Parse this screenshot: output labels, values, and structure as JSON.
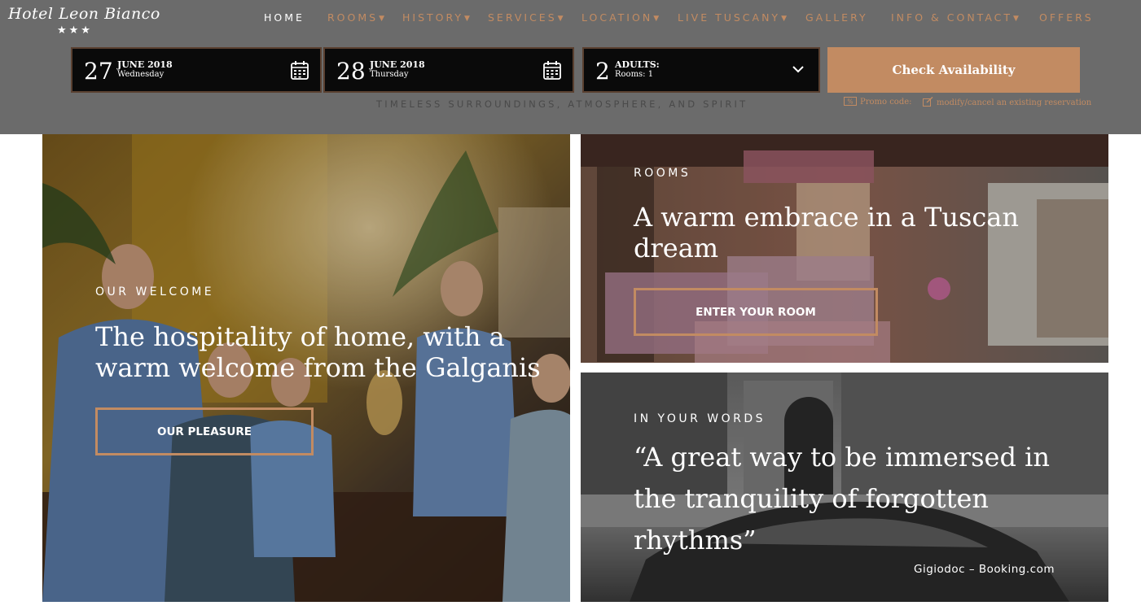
{
  "logo": {
    "name": "Hotel Leon Bianco",
    "stars": "★★★"
  },
  "nav": [
    {
      "label": "HOME",
      "has_dropdown": false,
      "active": true
    },
    {
      "label": "ROOMS",
      "has_dropdown": true,
      "active": false
    },
    {
      "label": "HISTORY",
      "has_dropdown": true,
      "active": false
    },
    {
      "label": "SERVICES",
      "has_dropdown": true,
      "active": false
    },
    {
      "label": "LOCATION",
      "has_dropdown": true,
      "active": false
    },
    {
      "label": "LIVE TUSCANY",
      "has_dropdown": true,
      "active": false
    },
    {
      "label": "GALLERY",
      "has_dropdown": false,
      "active": false
    },
    {
      "label": "INFO & CONTACT",
      "has_dropdown": true,
      "active": false
    },
    {
      "label": "OFFERS",
      "has_dropdown": false,
      "active": false
    }
  ],
  "booking": {
    "checkin": {
      "day": "27",
      "month_year": "JUNE 2018",
      "weekday": "Wednesday"
    },
    "checkout": {
      "day": "28",
      "month_year": "JUNE 2018",
      "weekday": "Thursday"
    },
    "guests": {
      "count": "2",
      "label": "ADULTS:",
      "rooms": "Rooms: 1"
    },
    "check_label": "Check Availability",
    "promo_label": "Promo code:",
    "modify_label": "modify/cancel an existing reservation"
  },
  "tagline": "TIMELESS SURROUNDINGS, ATMOSPHERE, AND SPIRIT",
  "panels": {
    "welcome": {
      "eyebrow": "OUR WELCOME",
      "headline_line1": "The hospitality of home, with a",
      "headline_line2": "warm welcome from the Galganis",
      "button": "OUR PLEASURE"
    },
    "rooms": {
      "eyebrow": "ROOMS",
      "headline_line1": "A warm embrace in a Tuscan",
      "headline_line2": "dream",
      "button": "ENTER YOUR ROOM"
    },
    "words": {
      "eyebrow": "IN YOUR WORDS",
      "quote_line1": "“A great way to be immersed in",
      "quote_line2": "the tranquility of forgotten",
      "quote_line3": "rhythms”",
      "author": "Gigiodoc – Booking.com"
    }
  },
  "colors": {
    "accent": "#c28b62",
    "header_bg": "#6b6b6b",
    "booking_box_bg": "#0a0a0a"
  }
}
